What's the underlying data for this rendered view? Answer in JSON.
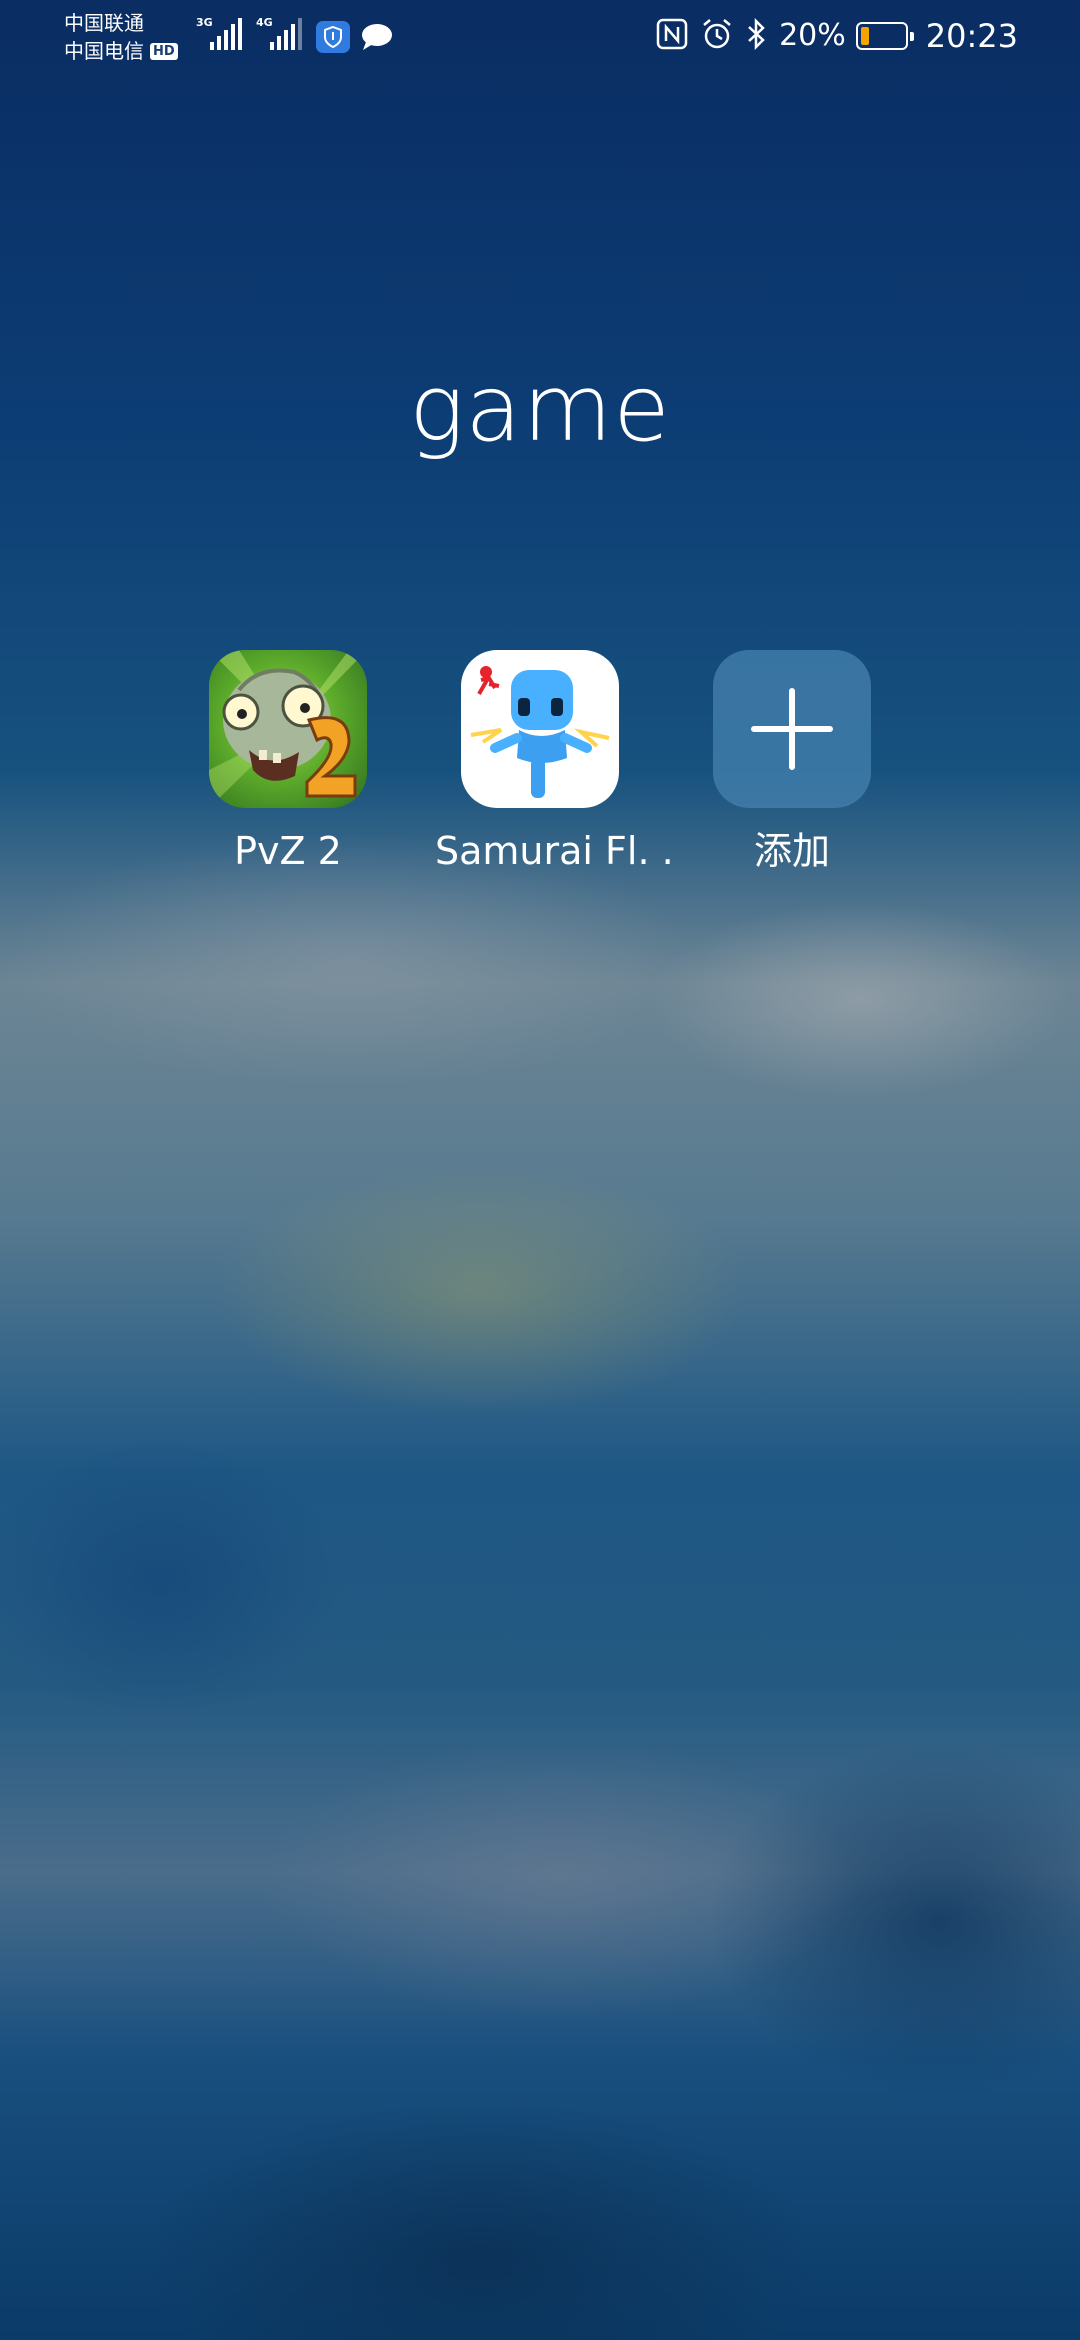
{
  "status_bar": {
    "carrier_1": "中国联通",
    "carrier_2": "中国电信",
    "hd_badge": "HD",
    "network_1": "3G",
    "network_2": "4G",
    "battery_percent": "20%",
    "battery_level": 0.2,
    "time": "20:23"
  },
  "folder": {
    "title": "game",
    "apps": [
      {
        "label": "PvZ 2",
        "icon": "pvz2-icon"
      },
      {
        "label": "Samurai Fl. .",
        "icon": "samurai-flash-icon"
      },
      {
        "label": "添加",
        "icon": "plus-icon"
      }
    ]
  },
  "colors": {
    "battery_fill": "#f5a300",
    "shield_bg": "#2f7be0",
    "add_tile": "#4682af"
  }
}
